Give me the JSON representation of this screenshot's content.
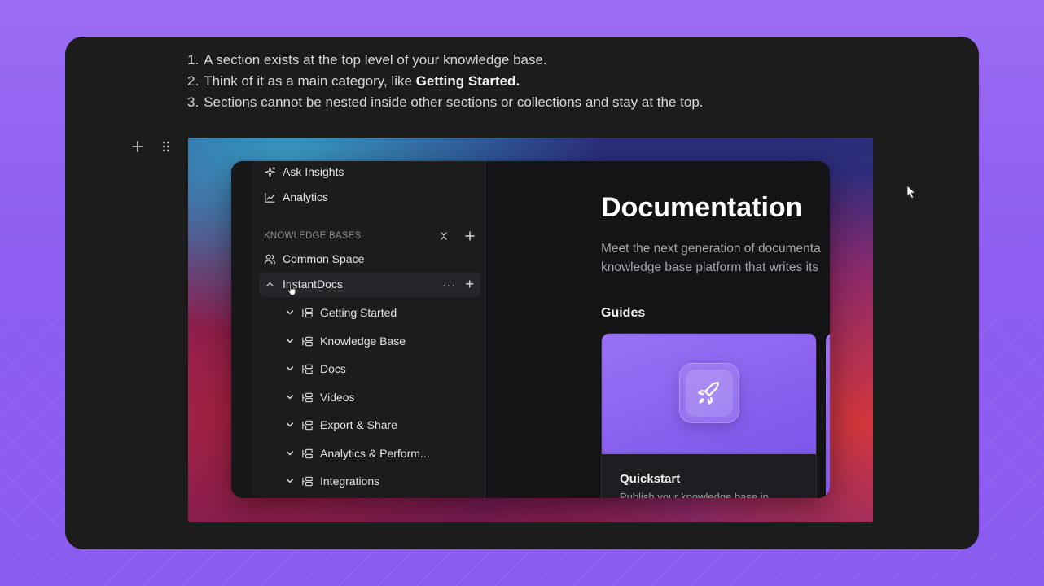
{
  "steps": [
    {
      "num": "1.",
      "text": "A section exists at the top level of your knowledge base."
    },
    {
      "num": "2.",
      "text_before": "Think of it as a main category, like ",
      "bold": "Getting Started",
      "text_after": "."
    },
    {
      "num": "3.",
      "text": "Sections cannot be nested inside other sections or collections and stay at the top."
    }
  ],
  "block_controls": {
    "add_icon": "plus-icon",
    "drag_icon": "drag-handle-icon"
  },
  "sidebar": {
    "nav": [
      {
        "label": "Ask Insights",
        "icon": "sparkles-icon"
      },
      {
        "label": "Analytics",
        "icon": "chart-line-icon"
      }
    ],
    "knowledge_bases_header": "KNOWLEDGE BASES",
    "knowledge_bases": [
      {
        "label": "Common Space",
        "icon": "users-icon"
      },
      {
        "label": "InstantDocs",
        "icon": "chevron-icon",
        "active": true
      }
    ],
    "sections": [
      "Getting Started",
      "Knowledge Base",
      "Docs",
      "Videos",
      "Export & Share",
      "Analytics & Perform...",
      "Integrations"
    ]
  },
  "content": {
    "title": "Documentation",
    "subtitle_line1": "Meet the next generation of documenta",
    "subtitle_line2": "knowledge base platform that writes its",
    "guides_label": "Guides",
    "card": {
      "title": "Quickstart",
      "description": "Publish your knowledge base in",
      "icon": "rocket-icon"
    }
  },
  "colors": {
    "accent": "#8b5cf0",
    "editor_bg": "#1c1c1c",
    "app_bg": "#141416"
  }
}
